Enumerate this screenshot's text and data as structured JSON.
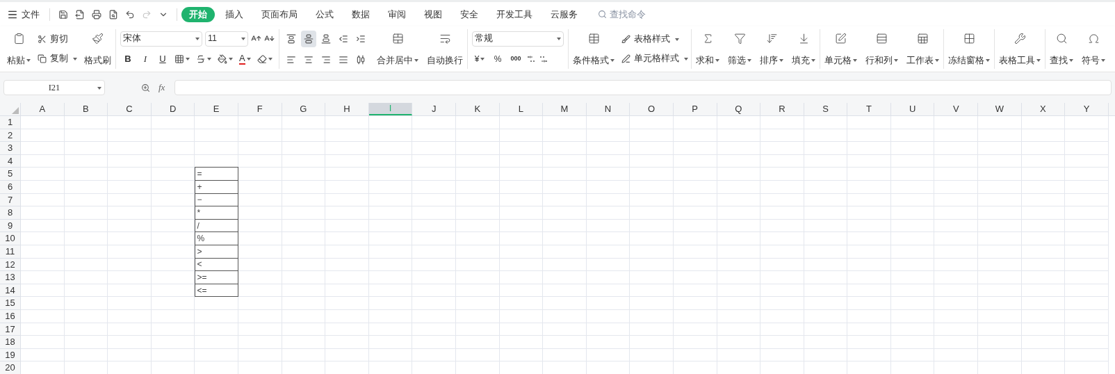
{
  "top_bar": {
    "menu_label": "文件",
    "redo_disabled": true,
    "tabs": [
      {
        "label": "开始",
        "selected": true
      },
      {
        "label": "插入",
        "selected": false
      },
      {
        "label": "页面布局",
        "selected": false
      },
      {
        "label": "公式",
        "selected": false
      },
      {
        "label": "数据",
        "selected": false
      },
      {
        "label": "审阅",
        "selected": false
      },
      {
        "label": "视图",
        "selected": false
      },
      {
        "label": "安全",
        "selected": false
      },
      {
        "label": "开发工具",
        "selected": false
      },
      {
        "label": "云服务",
        "selected": false
      }
    ],
    "search": {
      "placeholder": "查找命令"
    }
  },
  "ribbon": {
    "clipboard": {
      "paste": "粘贴",
      "cut": "剪切",
      "copy": "复制",
      "format_painter": "格式刷"
    },
    "font": {
      "name": "宋体",
      "size": "11",
      "bold": "B",
      "italic": "I",
      "underline": "U",
      "font_color": "A"
    },
    "align_buttons": [
      {
        "kind": "top",
        "selected": false
      },
      {
        "kind": "middle",
        "selected": true
      },
      {
        "kind": "bottom",
        "selected": false
      },
      {
        "kind": "outdent",
        "selected": false
      },
      {
        "kind": "indent",
        "selected": false
      },
      {
        "kind": "left",
        "selected": false
      },
      {
        "kind": "center",
        "selected": false
      },
      {
        "kind": "right",
        "selected": false
      },
      {
        "kind": "justify",
        "selected": false
      },
      {
        "kind": "distributed",
        "selected": false
      }
    ],
    "merge": "合并居中",
    "wrap": "自动换行",
    "number": {
      "format": "常规",
      "currency": "¥",
      "percent": "%",
      "thousands": "000"
    },
    "styles": {
      "conditional": "条件格式",
      "table_style": "表格样式",
      "cell_style": "单元格样式"
    },
    "tools": [
      {
        "kind": "sum",
        "label": "求和"
      },
      {
        "kind": "filter",
        "label": "筛选"
      },
      {
        "kind": "sort",
        "label": "排序"
      },
      {
        "kind": "fill",
        "label": "填充"
      },
      {
        "kind": "divider"
      },
      {
        "kind": "cell",
        "label": "单元格"
      },
      {
        "kind": "rowcol",
        "label": "行和列"
      },
      {
        "kind": "sheet",
        "label": "工作表"
      },
      {
        "kind": "divider"
      },
      {
        "kind": "freeze",
        "label": "冻结窗格"
      },
      {
        "kind": "divider"
      },
      {
        "kind": "tabletool",
        "label": "表格工具"
      },
      {
        "kind": "divider"
      },
      {
        "kind": "find",
        "label": "查找"
      },
      {
        "kind": "symbol",
        "label": "符号"
      }
    ]
  },
  "formula_bar": {
    "cell_ref": "I21",
    "fx_label": "fx"
  },
  "sheet": {
    "columns": [
      {
        "label": "A",
        "selected": false
      },
      {
        "label": "B",
        "selected": false
      },
      {
        "label": "C",
        "selected": false
      },
      {
        "label": "D",
        "selected": false
      },
      {
        "label": "E",
        "selected": false
      },
      {
        "label": "F",
        "selected": false
      },
      {
        "label": "G",
        "selected": false
      },
      {
        "label": "H",
        "selected": false
      },
      {
        "label": "I",
        "selected": true
      },
      {
        "label": "J",
        "selected": false
      },
      {
        "label": "K",
        "selected": false
      },
      {
        "label": "L",
        "selected": false
      },
      {
        "label": "M",
        "selected": false
      },
      {
        "label": "N",
        "selected": false
      },
      {
        "label": "O",
        "selected": false
      },
      {
        "label": "P",
        "selected": false
      },
      {
        "label": "Q",
        "selected": false
      },
      {
        "label": "R",
        "selected": false
      },
      {
        "label": "S",
        "selected": false
      },
      {
        "label": "T",
        "selected": false
      },
      {
        "label": "U",
        "selected": false
      },
      {
        "label": "V",
        "selected": false
      },
      {
        "label": "W",
        "selected": false
      },
      {
        "label": "X",
        "selected": false
      },
      {
        "label": "Y",
        "selected": false
      }
    ],
    "rows": [
      {
        "label": "1"
      },
      {
        "label": "2"
      },
      {
        "label": "3"
      },
      {
        "label": "4"
      },
      {
        "label": "5",
        "column_e": "="
      },
      {
        "label": "6",
        "column_e": "+"
      },
      {
        "label": "7",
        "column_e": "−"
      },
      {
        "label": "8",
        "column_e": "*"
      },
      {
        "label": "9",
        "column_e": "/"
      },
      {
        "label": "10",
        "column_e": "%"
      },
      {
        "label": "11",
        "column_e": ">"
      },
      {
        "label": "12",
        "column_e": "<"
      },
      {
        "label": "13",
        "column_e": ">="
      },
      {
        "label": "14",
        "column_e": "<="
      },
      {
        "label": "15"
      },
      {
        "label": "16"
      },
      {
        "label": "17"
      },
      {
        "label": "18"
      },
      {
        "label": "19"
      },
      {
        "label": "20"
      }
    ]
  }
}
